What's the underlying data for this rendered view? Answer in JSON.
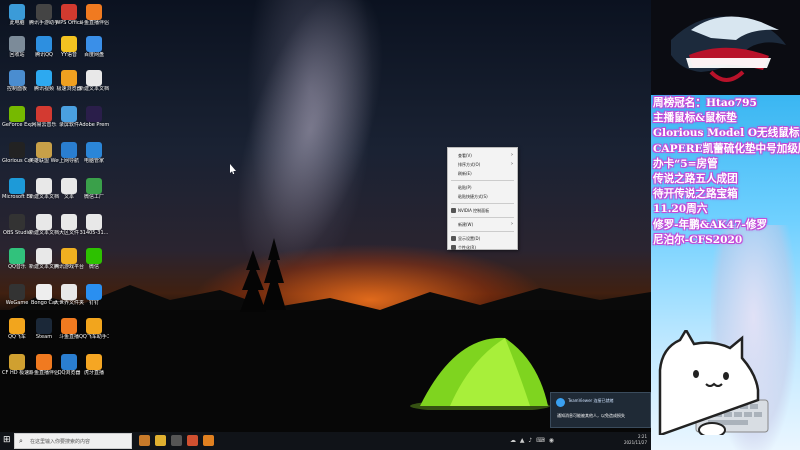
{
  "desktop": {
    "icons": [
      {
        "label": "此电脑",
        "color": "#3b9bd8"
      },
      {
        "label": "腾讯手游助手",
        "color": "#444"
      },
      {
        "label": "WPS Office",
        "color": "#d23a2f"
      },
      {
        "label": "斗鱼直播伴侣",
        "color": "#f07a20"
      },
      {
        "label": "回收站",
        "color": "#7c8b99"
      },
      {
        "label": "腾讯QQ",
        "color": "#2d8fe0"
      },
      {
        "label": "YY语音",
        "color": "#f3c321"
      },
      {
        "label": "百度网盘",
        "color": "#3a8fe8"
      },
      {
        "label": "控制面板",
        "color": "#4a8dd0"
      },
      {
        "label": "腾讯视频",
        "color": "#2da9f0"
      },
      {
        "label": "极速浏览器",
        "color": "#f0a020"
      },
      {
        "label": "新建文本文档",
        "color": "#e8e8e8"
      },
      {
        "label": "GeForce Experience",
        "color": "#76b900"
      },
      {
        "label": "网易云音乐",
        "color": "#d33a31"
      },
      {
        "label": "录屏软件",
        "color": "#4aa0e0"
      },
      {
        "label": "Adobe Premiere",
        "color": "#2a1e4a"
      },
      {
        "label": "Glorious Core",
        "color": "#222"
      },
      {
        "label": "英雄联盟 WeGame版",
        "color": "#c8a048"
      },
      {
        "label": "上网导航",
        "color": "#2a7ed0"
      },
      {
        "label": "电脑管家",
        "color": "#2b86d8"
      },
      {
        "label": "Microsoft Edge",
        "color": "#1d9ad8"
      },
      {
        "label": "新建文本文档",
        "color": "#e8e8e8"
      },
      {
        "label": "文本",
        "color": "#e8e8e8"
      },
      {
        "label": "微信工厂",
        "color": "#3aa04a"
      },
      {
        "label": "OBS Studio",
        "color": "#333"
      },
      {
        "label": "新建文本文档(2)",
        "color": "#e8e8e8"
      },
      {
        "label": "大区文件",
        "color": "#e8e8e8"
      },
      {
        "label": "31405-31...",
        "color": "#e8e8e8"
      },
      {
        "label": "QQ音乐",
        "color": "#31c27c"
      },
      {
        "label": "新建文本文档(3)",
        "color": "#e8e8e8"
      },
      {
        "label": "腾讯游戏平台",
        "color": "#f0b020"
      },
      {
        "label": "微信",
        "color": "#2dc100"
      },
      {
        "label": "WeGame",
        "color": "#333"
      },
      {
        "label": "Bongo Cat",
        "color": "#eee"
      },
      {
        "label": "大世界文件夹",
        "color": "#e8e8e8"
      },
      {
        "label": "钉钉",
        "color": "#2a8ff0"
      },
      {
        "label": "QQ飞车",
        "color": "#f2a51d"
      },
      {
        "label": "Steam",
        "color": "#1b2838"
      },
      {
        "label": "斗鱼直播",
        "color": "#f07a20"
      },
      {
        "label": "QQ飞车助手工具",
        "color": "#f2a51d"
      },
      {
        "label": "CF HD 极速版大区",
        "color": "#d0a030"
      },
      {
        "label": "斗鱼直播伴侣",
        "color": "#f07a20"
      },
      {
        "label": "QQ浏览器",
        "color": "#2a7ed0"
      },
      {
        "label": "虎牙直播",
        "color": "#f5a623"
      }
    ]
  },
  "context_menu": {
    "items": [
      {
        "label": "查看(V)",
        "arrow": "›",
        "icon": false
      },
      {
        "label": "排序方式(O)",
        "arrow": "›",
        "icon": false
      },
      {
        "label": "刷新(E)",
        "arrow": "",
        "icon": false
      },
      {
        "sep": true
      },
      {
        "label": "粘贴(P)",
        "arrow": "",
        "icon": false
      },
      {
        "label": "粘贴快捷方式(S)",
        "arrow": "",
        "icon": false
      },
      {
        "sep": true
      },
      {
        "label": "NVIDIA 控制面板",
        "arrow": "",
        "icon": true
      },
      {
        "sep": true
      },
      {
        "label": "新建(W)",
        "arrow": "›",
        "icon": false
      },
      {
        "sep": true
      },
      {
        "label": "显示设置(D)",
        "arrow": "",
        "icon": true
      },
      {
        "label": "个性化(R)",
        "arrow": "",
        "icon": true
      }
    ]
  },
  "notification": {
    "title": "TeamViewer 连接已就绪",
    "body": "通知消息可能被其他人，以免造成损失"
  },
  "taskbar": {
    "start_glyph": "⊞",
    "search_placeholder": "在这里输入你要搜索的内容",
    "time": "2:21",
    "date": "2021/11/27",
    "apps": [
      {
        "color": "#c87a2a"
      },
      {
        "color": "#e0b030"
      },
      {
        "color": "#555"
      },
      {
        "color": "#d05030"
      },
      {
        "color": "#e08020"
      }
    ]
  },
  "panel": {
    "lines": [
      "周榜冠名：Htao795",
      "主播鼠标&鼠标垫",
      "Glorious Model O无线鼠标",
      "CAPERE凯蕾硫化垫中号加级版",
      "办卡“5=房管",
      "传说之路五人成团",
      "待开传说之路宝箱",
      "11.20周六",
      "修罗-年鹏&AK47-修罗",
      "尼泊尔-CFS2020"
    ]
  }
}
